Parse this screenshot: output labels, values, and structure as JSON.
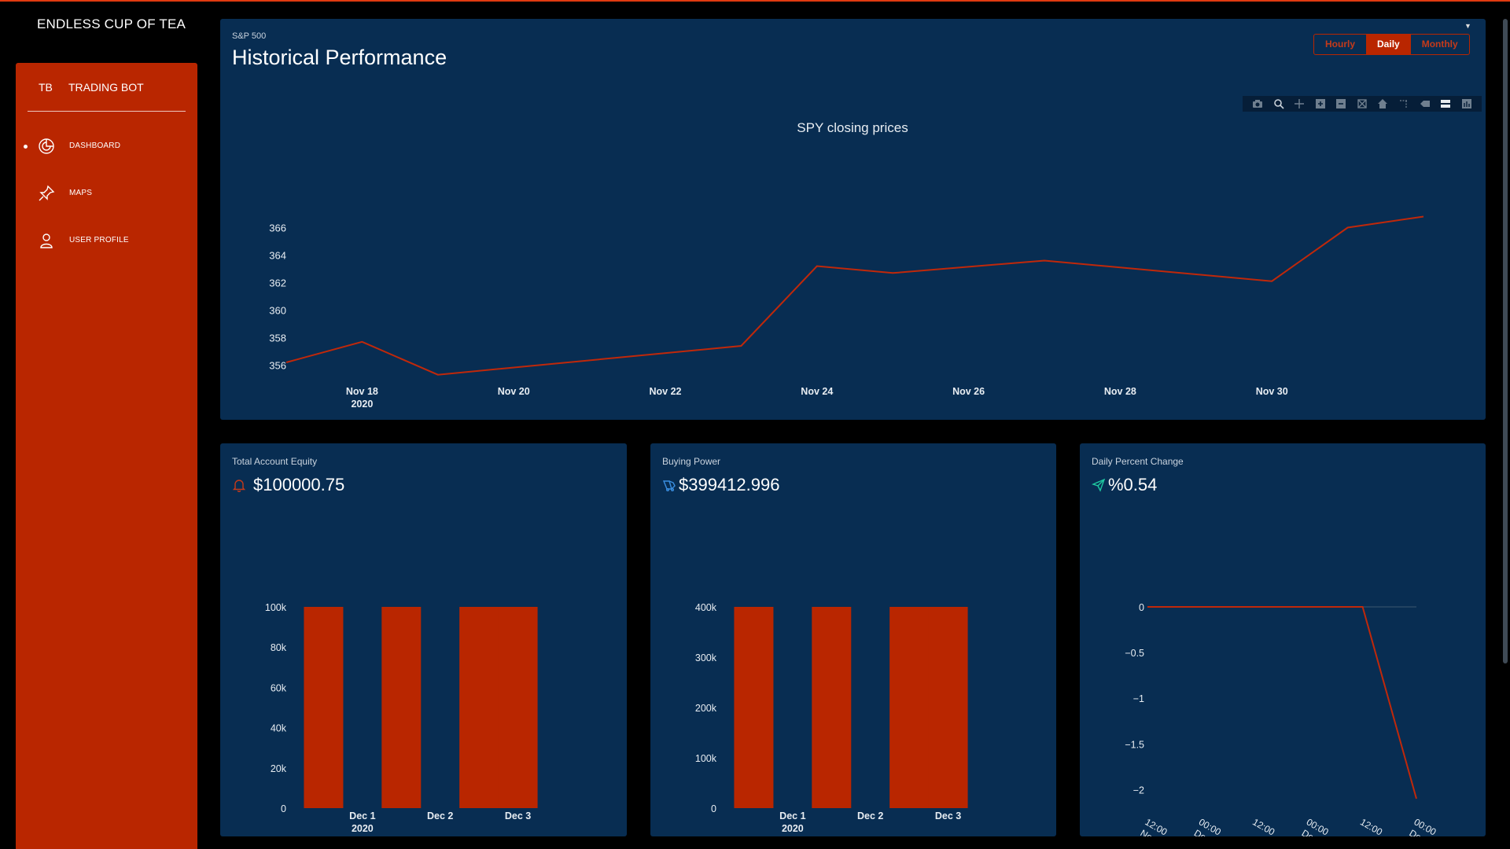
{
  "app": {
    "brand": "ENDLESS CUP OF TEA"
  },
  "sidebar": {
    "abbr": "TB",
    "name": "TRADING BOT",
    "items": [
      {
        "label": "DASHBOARD",
        "icon": "chart-pie-icon",
        "active": true
      },
      {
        "label": "MAPS",
        "icon": "pin-icon",
        "active": false
      },
      {
        "label": "USER PROFILE",
        "icon": "user-icon",
        "active": false
      }
    ]
  },
  "performance": {
    "subtitle": "S&P 500",
    "title": "Historical Performance",
    "periods": [
      "Hourly",
      "Daily",
      "Monthly"
    ],
    "active_period": "Daily"
  },
  "cards": {
    "equity": {
      "label": "Total Account Equity",
      "value": "$100000.75",
      "icon": "bell-icon"
    },
    "buying_power": {
      "label": "Buying Power",
      "value": "$399412.996",
      "icon": "delivery-icon"
    },
    "daily_change": {
      "label": "Daily Percent Change",
      "value": "%0.54",
      "icon": "send-icon"
    }
  },
  "colors": {
    "accent": "#b92600",
    "line": "#c0280a",
    "card": "#082d52",
    "background": "#000000"
  },
  "chart_data": [
    {
      "type": "line",
      "title": "SPY closing prices",
      "x": [
        "2020-11-17",
        "2020-11-18",
        "2020-11-19",
        "2020-11-23",
        "2020-11-24",
        "2020-11-25",
        "2020-11-27",
        "2020-11-30",
        "2020-12-01",
        "2020-12-02"
      ],
      "values": [
        356.2,
        357.7,
        355.3,
        357.4,
        363.2,
        362.7,
        363.6,
        362.1,
        366.0,
        366.8
      ],
      "ylim": [
        355,
        367
      ],
      "yticks": [
        356,
        358,
        360,
        362,
        364,
        366
      ],
      "xtick_labels": [
        {
          "date": "2020-11-18",
          "label": "Nov 18",
          "sub": "2020"
        },
        {
          "date": "2020-11-20",
          "label": "Nov 20"
        },
        {
          "date": "2020-11-22",
          "label": "Nov 22"
        },
        {
          "date": "2020-11-24",
          "label": "Nov 24"
        },
        {
          "date": "2020-11-26",
          "label": "Nov 26"
        },
        {
          "date": "2020-11-28",
          "label": "Nov 28"
        },
        {
          "date": "2020-11-30",
          "label": "Nov 30"
        }
      ],
      "xlabel": "",
      "ylabel": ""
    },
    {
      "type": "bar",
      "title": "",
      "x": [
        "2020-11-30",
        "2020-12-01",
        "2020-12-02",
        "2020-12-03",
        "2020-12-04"
      ],
      "values": [
        100000,
        0,
        100000,
        0,
        100000,
        100000
      ],
      "bars": [
        {
          "date": "2020-11-30T12:00",
          "value": 100000
        },
        {
          "date": "2020-12-01T12:00",
          "value": 100000
        },
        {
          "date": "2020-12-02T12:00",
          "value": 100000
        },
        {
          "date": "2020-12-03T00:00",
          "value": 100000
        }
      ],
      "ylim": [
        0,
        100000
      ],
      "yticks": [
        {
          "v": 0,
          "t": "0"
        },
        {
          "v": 20000,
          "t": "20k"
        },
        {
          "v": 40000,
          "t": "40k"
        },
        {
          "v": 60000,
          "t": "60k"
        },
        {
          "v": 80000,
          "t": "80k"
        },
        {
          "v": 100000,
          "t": "100k"
        }
      ],
      "xtick_labels": [
        {
          "date": "2020-12-01",
          "label": "Dec 1",
          "sub": "2020"
        },
        {
          "date": "2020-12-02",
          "label": "Dec 2"
        },
        {
          "date": "2020-12-03",
          "label": "Dec 3"
        }
      ],
      "xlabel": "",
      "ylabel": ""
    },
    {
      "type": "bar",
      "title": "",
      "bars": [
        {
          "date": "2020-11-30T12:00",
          "value": 400000
        },
        {
          "date": "2020-12-01T12:00",
          "value": 400000
        },
        {
          "date": "2020-12-02T12:00",
          "value": 400000
        },
        {
          "date": "2020-12-03T00:00",
          "value": 400000
        }
      ],
      "ylim": [
        0,
        400000
      ],
      "yticks": [
        {
          "v": 0,
          "t": "0"
        },
        {
          "v": 100000,
          "t": "100k"
        },
        {
          "v": 200000,
          "t": "200k"
        },
        {
          "v": 300000,
          "t": "300k"
        },
        {
          "v": 400000,
          "t": "400k"
        }
      ],
      "xtick_labels": [
        {
          "date": "2020-12-01",
          "label": "Dec 1",
          "sub": "2020"
        },
        {
          "date": "2020-12-02",
          "label": "Dec 2"
        },
        {
          "date": "2020-12-03",
          "label": "Dec 3"
        }
      ],
      "xlabel": "",
      "ylabel": ""
    },
    {
      "type": "line",
      "title": "",
      "x": [
        "2020-11-30T12:00",
        "2020-12-01T00:00",
        "2020-12-01T12:00",
        "2020-12-02T00:00",
        "2020-12-02T12:00",
        "2020-12-03T00:00"
      ],
      "values": [
        0,
        0,
        0,
        0,
        0,
        -2.1
      ],
      "ylim": [
        -2.1,
        0
      ],
      "yticks": [
        {
          "v": 0,
          "t": "0"
        },
        {
          "v": -0.5,
          "t": "−0.5"
        },
        {
          "v": -1,
          "t": "−1"
        },
        {
          "v": -1.5,
          "t": "−1.5"
        },
        {
          "v": -2,
          "t": "−2"
        }
      ],
      "xtick_labels": [
        "12:00",
        "00:00",
        "12:00",
        "00:00",
        "12:00",
        "00:00"
      ],
      "xtick_sub": [
        "Nov",
        "Dec",
        "",
        "Dec",
        "",
        "Dec"
      ],
      "xlabel": "",
      "ylabel": ""
    }
  ]
}
